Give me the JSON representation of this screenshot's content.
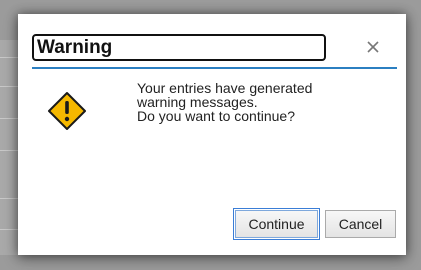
{
  "dialog": {
    "title": "Warning",
    "close_icon": "close-icon",
    "warning_icon": "warning-diamond-icon",
    "message_lines": [
      "Your entries have generated",
      "warning messages.",
      "Do you want to continue?"
    ],
    "buttons": {
      "continue_label": "Continue",
      "cancel_label": "Cancel"
    }
  },
  "colors": {
    "accent_divider": "#2b7fc1",
    "warning_fill": "#f5b800",
    "warning_stroke": "#1a1a1a"
  }
}
